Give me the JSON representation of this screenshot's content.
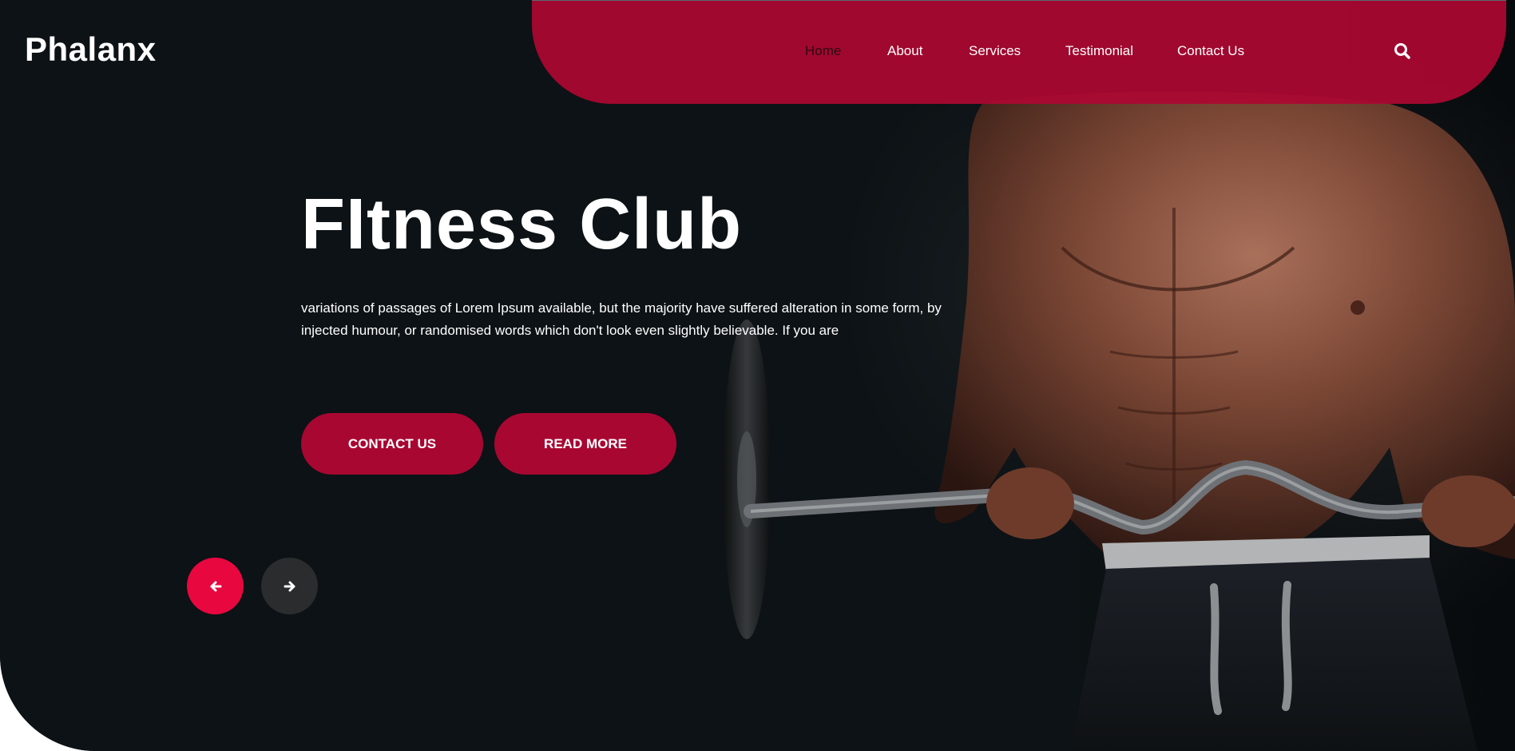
{
  "brand": {
    "name": "Phalanx"
  },
  "nav": {
    "items": [
      {
        "label": "Home",
        "active": true
      },
      {
        "label": "About",
        "active": false
      },
      {
        "label": "Services",
        "active": false
      },
      {
        "label": "Testimonial",
        "active": false
      },
      {
        "label": "Contact Us",
        "active": false
      }
    ],
    "search_icon": "search-icon"
  },
  "hero": {
    "title": "FItness Club",
    "text": "variations of passages of Lorem Ipsum available, but the majority have suffered alteration in some form, by injected humour, or randomised words which don't look even slightly believable. If you are",
    "buttons": {
      "contact": "CONTACT US",
      "read_more": "READ MORE"
    }
  },
  "slider": {
    "prev_icon": "arrow-left-icon",
    "next_icon": "arrow-right-icon"
  },
  "colors": {
    "accent": "#a80732",
    "accent_bright": "#e8073f",
    "background": "#0c1215"
  }
}
